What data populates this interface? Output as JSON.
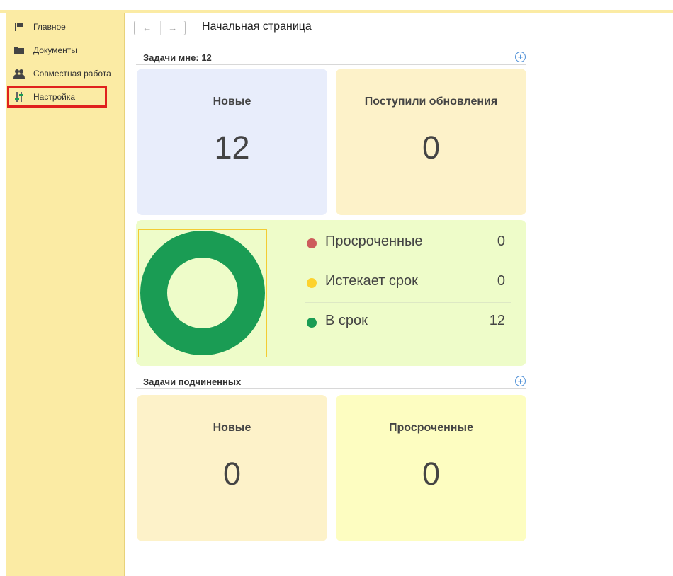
{
  "sidebar": {
    "items": [
      {
        "label": "Главное",
        "icon": "flag-icon"
      },
      {
        "label": "Документы",
        "icon": "folder-icon"
      },
      {
        "label": "Совместная работа",
        "icon": "users-icon"
      },
      {
        "label": "Настройка",
        "icon": "settings-sliders-icon"
      }
    ],
    "highlight_color": "#e0211d"
  },
  "navigation": {
    "back": "←",
    "forward": "→"
  },
  "page": {
    "title": "Начальная страница"
  },
  "my_tasks": {
    "header": "Задачи мне: 12",
    "add": "+",
    "cards": [
      {
        "title": "Новые",
        "value": "12",
        "color": "#e8edfb"
      },
      {
        "title": "Поступили обновления",
        "value": "0",
        "color": "#fdf2c9"
      }
    ],
    "status": {
      "donut_color": "#1a9c54",
      "legend": [
        {
          "label": "Просроченные",
          "value": "0",
          "color": "#cd5c5c"
        },
        {
          "label": "Истекает срок",
          "value": "0",
          "color": "#fdd22e"
        },
        {
          "label": "В срок",
          "value": "12",
          "color": "#1a9c54"
        }
      ]
    }
  },
  "subordinate_tasks": {
    "header": "Задачи подчиненных",
    "add": "+",
    "cards": [
      {
        "title": "Новые",
        "value": "0",
        "color": "#fdf2c9"
      },
      {
        "title": "Просроченные",
        "value": "0",
        "color": "#fdfdc1"
      }
    ]
  }
}
